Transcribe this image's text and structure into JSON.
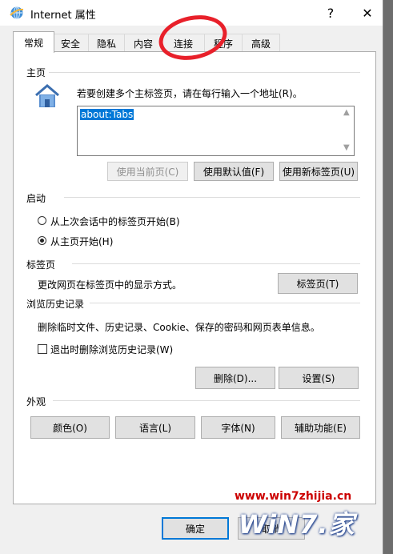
{
  "window": {
    "title": "Internet 属性",
    "help_glyph": "?",
    "close_glyph": "✕"
  },
  "tabs": [
    {
      "label": "常规",
      "active": true
    },
    {
      "label": "安全"
    },
    {
      "label": "隐私"
    },
    {
      "label": "内容"
    },
    {
      "label": "连接"
    },
    {
      "label": "程序"
    },
    {
      "label": "高级"
    }
  ],
  "home": {
    "section_label": "主页",
    "instruction": "若要创建多个主标签页，请在每行输入一个地址(R)。",
    "value": "about:Tabs",
    "btn_current": "使用当前页(C)",
    "btn_default": "使用默认值(F)",
    "btn_new_tab": "使用新标签页(U)"
  },
  "startup": {
    "section_label": "启动",
    "option_last": "从上次会话中的标签页开始(B)",
    "option_home": "从主页开始(H)",
    "selected": "option_home"
  },
  "tabs_section": {
    "section_label": "标签页",
    "description": "更改网页在标签页中的显示方式。",
    "button": "标签页(T)"
  },
  "history": {
    "section_label": "浏览历史记录",
    "description": "删除临时文件、历史记录、Cookie、保存的密码和网页表单信息。",
    "checkbox_label": "退出时删除浏览历史记录(W)",
    "checked": false,
    "btn_delete": "删除(D)...",
    "btn_settings": "设置(S)"
  },
  "appearance": {
    "section_label": "外观",
    "btn_colors": "颜色(O)",
    "btn_languages": "语言(L)",
    "btn_fonts": "字体(N)",
    "btn_accessibility": "辅助功能(E)"
  },
  "footer": {
    "ok": "确定",
    "cancel": "取消"
  },
  "watermark": {
    "url": "www.win7zhijia.cn",
    "logo": "WiN7.家"
  },
  "colors": {
    "accent": "#0078d7",
    "annotation": "#e8202a",
    "watermark": "#cc0000"
  }
}
